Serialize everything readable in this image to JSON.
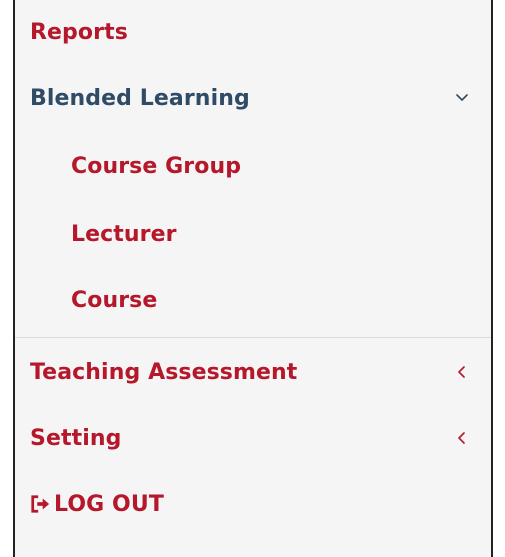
{
  "colors": {
    "accent": "#b5172b",
    "blended": "#2f4b66",
    "chevron": "#b5172b",
    "chevron_blended": "#2f4b66"
  },
  "menu": {
    "reports": {
      "label": "Reports"
    },
    "blended_learning": {
      "label": "Blended Learning",
      "expanded": true,
      "children": [
        {
          "label": "Course Group"
        },
        {
          "label": "Lecturer"
        },
        {
          "label": "Course"
        }
      ]
    },
    "teaching_assessment": {
      "label": "Teaching Assessment",
      "expanded": false
    },
    "setting": {
      "label": "Setting",
      "expanded": false
    },
    "logout": {
      "label": "LOG OUT",
      "icon": "logout-icon"
    }
  }
}
